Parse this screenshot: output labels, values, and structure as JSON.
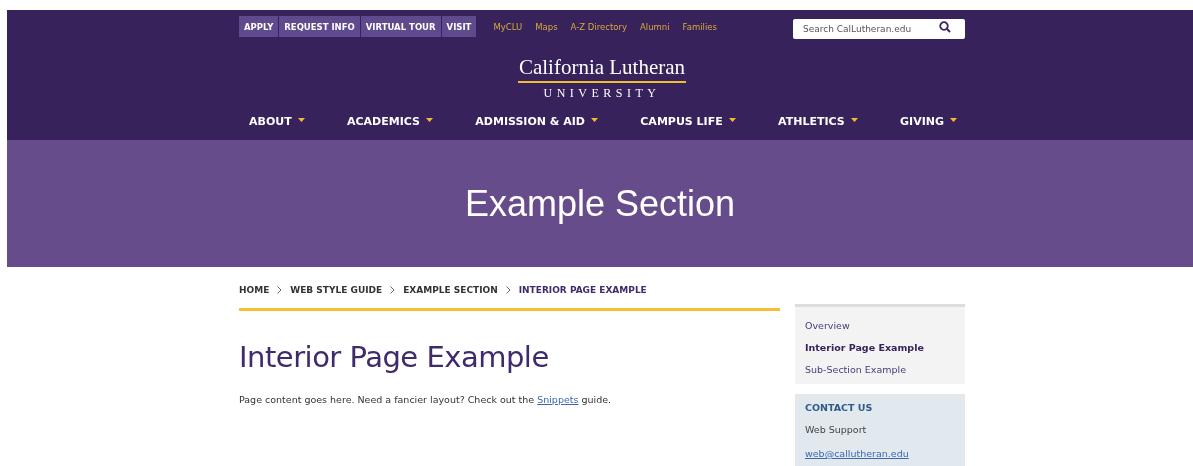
{
  "utility_buttons": [
    "APPLY",
    "REQUEST INFO",
    "VIRTUAL TOUR",
    "VISIT"
  ],
  "utility_links": [
    "MyCLU",
    "Maps",
    "A-Z Directory",
    "Alumni",
    "Families"
  ],
  "search": {
    "placeholder": "Search CalLutheran.edu"
  },
  "logo": {
    "name": "California Lutheran",
    "subtitle": "UNIVERSITY"
  },
  "main_nav": [
    {
      "label": "ABOUT"
    },
    {
      "label": "ACADEMICS"
    },
    {
      "label": "ADMISSION & AID"
    },
    {
      "label": "CAMPUS LIFE"
    },
    {
      "label": "ATHLETICS"
    },
    {
      "label": "GIVING"
    }
  ],
  "banner": {
    "title": "Example Section"
  },
  "breadcrumb": [
    {
      "label": "HOME",
      "current": false
    },
    {
      "label": "WEB STYLE GUIDE",
      "current": false
    },
    {
      "label": "EXAMPLE SECTION",
      "current": false
    },
    {
      "label": "INTERIOR PAGE EXAMPLE",
      "current": true
    }
  ],
  "page": {
    "title": "Interior Page Example",
    "text_before": "Page content goes here. Need a fancier layout? Check out the",
    "link": "Snippets",
    "text_after": "guide."
  },
  "side_nav": [
    {
      "label": "Overview",
      "selected": false
    },
    {
      "label": "Interior Page Example",
      "selected": true
    },
    {
      "label": "Sub-Section Example",
      "selected": false
    }
  ],
  "contact": {
    "heading": "CONTACT US",
    "name": "Web Support",
    "email": "web@callutheran.edu"
  }
}
